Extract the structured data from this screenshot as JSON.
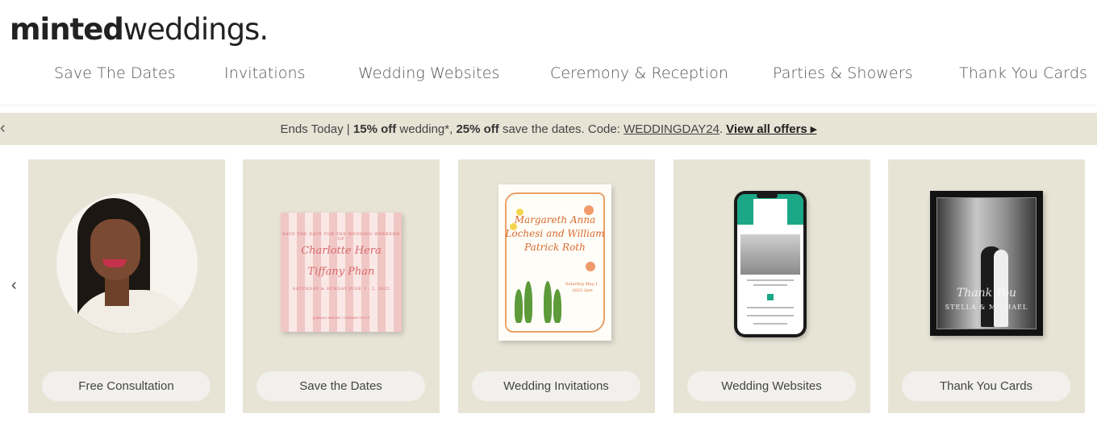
{
  "logo": {
    "part1": "minted",
    "part2": "weddings."
  },
  "nav": [
    "Save The Dates",
    "Invitations",
    "Wedding Websites",
    "Ceremony & Reception",
    "Parties & Showers",
    "Thank You Cards"
  ],
  "promo": {
    "prefix": "Ends Today | ",
    "off1": "15% off",
    "mid1": " wedding*, ",
    "off2": "25% off",
    "mid2": " save the dates. Code: ",
    "code": "WEDDINGDAY24",
    "dot": ".",
    "offers": "View all offers ▸"
  },
  "cards": [
    {
      "label": "Free Consultation"
    },
    {
      "label": "Save the Dates",
      "art": {
        "line1": "SAVE THE DATE FOR THE WEDDING WEEKEND OF",
        "name1": "Charlotte Hera",
        "name2": "Tiffany Phan",
        "line2": "SATURDAY & SUNDAY JUNE 1 - 2, 2025",
        "line3": "JORDAN HOUSE / CONNECTICUT"
      }
    },
    {
      "label": "Wedding Invitations",
      "art": {
        "names": "Margareth Anna Lochesi and William Patrick Roth",
        "detail": "Saturday May 1, 2025 2pm"
      }
    },
    {
      "label": "Wedding Websites"
    },
    {
      "label": "Thank You Cards",
      "art": {
        "script": "Thank You",
        "names": "STELLA & MICHAEL"
      }
    }
  ],
  "colors": {
    "accent": "#e7e4d6",
    "pill": "#f1f0ec",
    "website_green": "#1ba886"
  }
}
